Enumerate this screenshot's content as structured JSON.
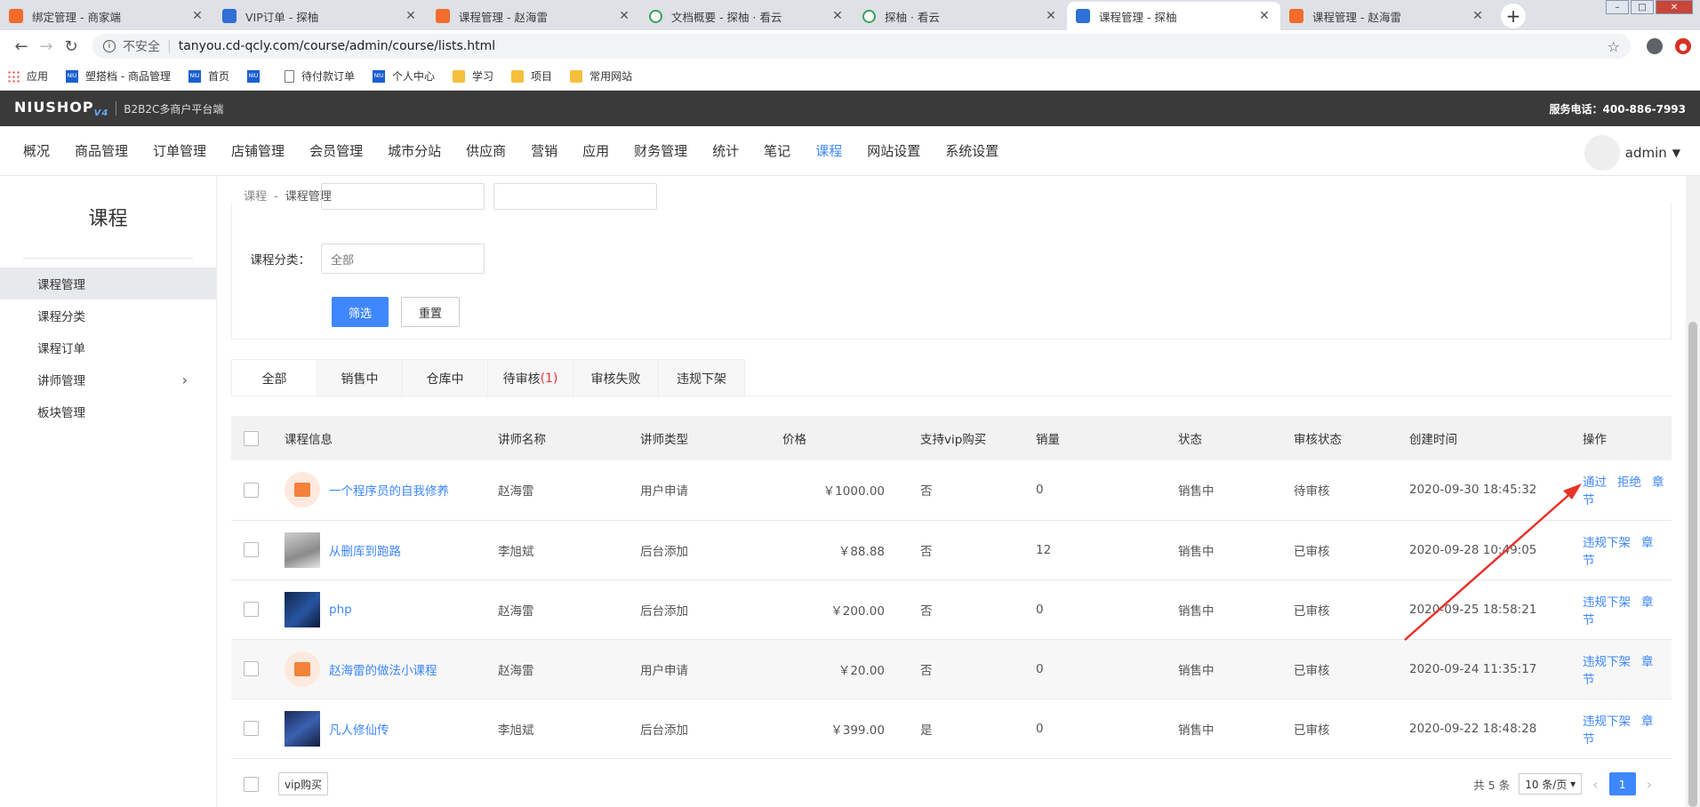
{
  "browser": {
    "tabs": [
      {
        "title": "绑定管理 - 商家端",
        "icon": "orange"
      },
      {
        "title": "VIP订单 - 探柚",
        "icon": "blue"
      },
      {
        "title": "课程管理 - 赵海雷",
        "icon": "orange"
      },
      {
        "title": "文档概要 - 探柚 · 看云",
        "icon": "green"
      },
      {
        "title": "探柚 · 看云",
        "icon": "green"
      },
      {
        "title": "课程管理 - 探柚",
        "icon": "blue"
      },
      {
        "title": "课程管理 - 赵海雷",
        "icon": "orange"
      }
    ],
    "active_tab": 5,
    "insecure_label": "不安全",
    "url": "tanyou.cd-qcly.com/course/admin/course/lists.html",
    "bookmarks": [
      {
        "label": "应用",
        "icon": "apps"
      },
      {
        "label": "塑搭档 - 商品管理",
        "icon": "niu"
      },
      {
        "label": "首页",
        "icon": "niu"
      },
      {
        "label": "",
        "icon": "niu"
      },
      {
        "label": "待付款订单",
        "icon": "doc"
      },
      {
        "label": "个人中心",
        "icon": "niu"
      },
      {
        "label": "学习",
        "icon": "folder"
      },
      {
        "label": "项目",
        "icon": "folder"
      },
      {
        "label": "常用网站",
        "icon": "folder"
      }
    ]
  },
  "header": {
    "logo": "NIUSHOP",
    "logo_version": "V4",
    "platform": "B2B2C多商户平台端",
    "hotline": "服务电话：400-886-7993"
  },
  "nav": {
    "items": [
      "概况",
      "商品管理",
      "订单管理",
      "店铺管理",
      "会员管理",
      "城市分站",
      "供应商",
      "营销",
      "应用",
      "财务管理",
      "统计",
      "笔记",
      "课程",
      "网站设置",
      "系统设置"
    ],
    "active": 12,
    "user": "admin"
  },
  "sidebar": {
    "title": "课程",
    "items": [
      {
        "label": "课程管理",
        "active": true,
        "arrow": false
      },
      {
        "label": "课程分类",
        "active": false,
        "arrow": false
      },
      {
        "label": "课程订单",
        "active": false,
        "arrow": false
      },
      {
        "label": "讲师管理",
        "active": false,
        "arrow": true
      },
      {
        "label": "板块管理",
        "active": false,
        "arrow": false
      }
    ]
  },
  "breadcrumb": {
    "root": "课程",
    "sep": "-",
    "current": "课程管理"
  },
  "filter": {
    "category_label": "课程分类：",
    "category_value": "全部",
    "filter_btn": "筛选",
    "reset_btn": "重置"
  },
  "tabs": [
    {
      "label": "全部",
      "count": ""
    },
    {
      "label": "销售中",
      "count": ""
    },
    {
      "label": "仓库中",
      "count": ""
    },
    {
      "label": "待审核",
      "count": "(1)"
    },
    {
      "label": "审核失败",
      "count": ""
    },
    {
      "label": "违规下架",
      "count": ""
    }
  ],
  "table": {
    "headers": [
      "课程信息",
      "讲师名称",
      "讲师类型",
      "价格",
      "支持vip购买",
      "销量",
      "状态",
      "审核状态",
      "创建时间",
      "操作"
    ],
    "rows": [
      {
        "thumb": "gift",
        "name": "一个程序员的自我修养",
        "teacher": "赵海雷",
        "type": "用户申请",
        "price": "￥1000.00",
        "vip": "否",
        "sales": "0",
        "status": "销售中",
        "audit": "待审核",
        "created": "2020-09-30 18:45:32",
        "ops": [
          "通过",
          "拒绝",
          "章节"
        ],
        "hl": false
      },
      {
        "thumb": "img1",
        "name": "从删库到跑路",
        "teacher": "李旭斌",
        "type": "后台添加",
        "price": "￥88.88",
        "vip": "否",
        "sales": "12",
        "status": "销售中",
        "audit": "已审核",
        "created": "2020-09-28 10:49:05",
        "ops": [
          "违规下架",
          "章节"
        ],
        "hl": false
      },
      {
        "thumb": "img2",
        "name": "php",
        "teacher": "赵海雷",
        "type": "后台添加",
        "price": "￥200.00",
        "vip": "否",
        "sales": "0",
        "status": "销售中",
        "audit": "已审核",
        "created": "2020-09-25 18:58:21",
        "ops": [
          "违规下架",
          "章节"
        ],
        "hl": false
      },
      {
        "thumb": "gift",
        "name": "赵海雷的做法小课程",
        "teacher": "赵海雷",
        "type": "用户申请",
        "price": "￥20.00",
        "vip": "否",
        "sales": "0",
        "status": "销售中",
        "audit": "已审核",
        "created": "2020-09-24 11:35:17",
        "ops": [
          "违规下架",
          "章节"
        ],
        "hl": true
      },
      {
        "thumb": "img3",
        "name": "凡人修仙传",
        "teacher": "李旭斌",
        "type": "后台添加",
        "price": "￥399.00",
        "vip": "是",
        "sales": "0",
        "status": "销售中",
        "audit": "已审核",
        "created": "2020-09-22 18:48:28",
        "ops": [
          "违规下架",
          "章节"
        ],
        "hl": false
      }
    ]
  },
  "footer": {
    "vip_btn": "vip购买",
    "total": "共 5 条",
    "page_size": "10 条/页",
    "page": "1"
  },
  "colors": {
    "accent": "#3e87ff",
    "annotation_arrow": "#e8322a"
  }
}
